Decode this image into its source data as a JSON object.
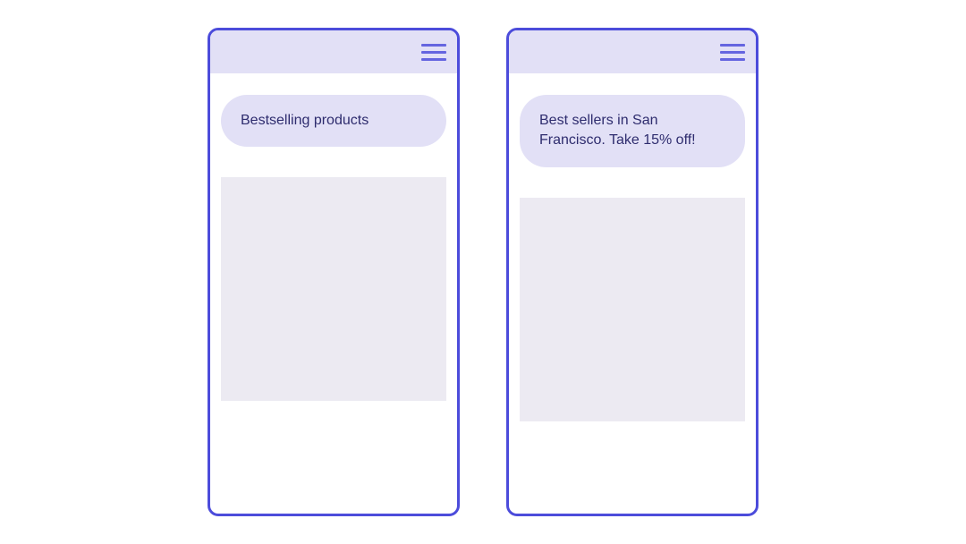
{
  "colors": {
    "frame_border": "#4c4cdb",
    "header_bg": "#e2e0f6",
    "hamburger": "#6565e0",
    "banner_bg": "#e2e0f6",
    "banner_text": "#2e2c6e",
    "placeholder_bg": "#eceaf2"
  },
  "frames": {
    "left": {
      "banner_text": "Bestselling products"
    },
    "right": {
      "banner_text": "Best sellers in San Francisco. Take 15% off!"
    }
  }
}
